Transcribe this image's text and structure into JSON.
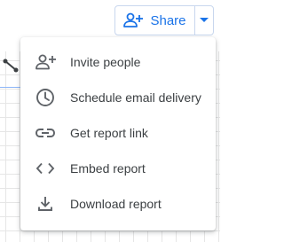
{
  "toolbar": {
    "share_label": "Share",
    "accent_color": "#1a73e8"
  },
  "share_menu": {
    "items": [
      {
        "label": "Invite people",
        "icon": "add-person-icon"
      },
      {
        "label": "Schedule email delivery",
        "icon": "clock-icon"
      },
      {
        "label": "Get report link",
        "icon": "link-icon"
      },
      {
        "label": "Embed report",
        "icon": "code-icon"
      },
      {
        "label": "Download report",
        "icon": "download-icon"
      }
    ]
  },
  "colors": {
    "menu_text": "#3c4043",
    "menu_icon": "#5f6368",
    "grid_line": "#e6e6e6"
  }
}
